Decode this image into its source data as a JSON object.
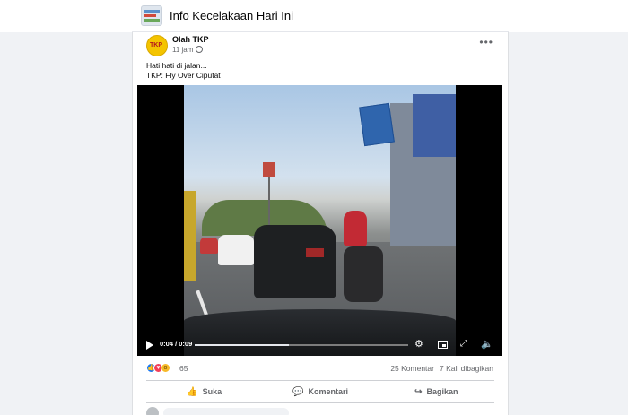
{
  "group": {
    "name": "Info Kecelakaan Hari Ini"
  },
  "post": {
    "author": "Olah TKP",
    "time": "11 jam",
    "caption_line1": "Hati hati di jalan...",
    "caption_line2": "TKP: Fly Over Ciputat",
    "more_label": "•••"
  },
  "video": {
    "time": "0:04 / 0:09",
    "progress_fraction": 0.44
  },
  "engagement": {
    "reaction_count": "65",
    "comments": "25 Komentar",
    "shares": "7 Kali dibagikan"
  },
  "actions": {
    "like": "Suka",
    "comment": "Komentari",
    "share": "Bagikan"
  }
}
